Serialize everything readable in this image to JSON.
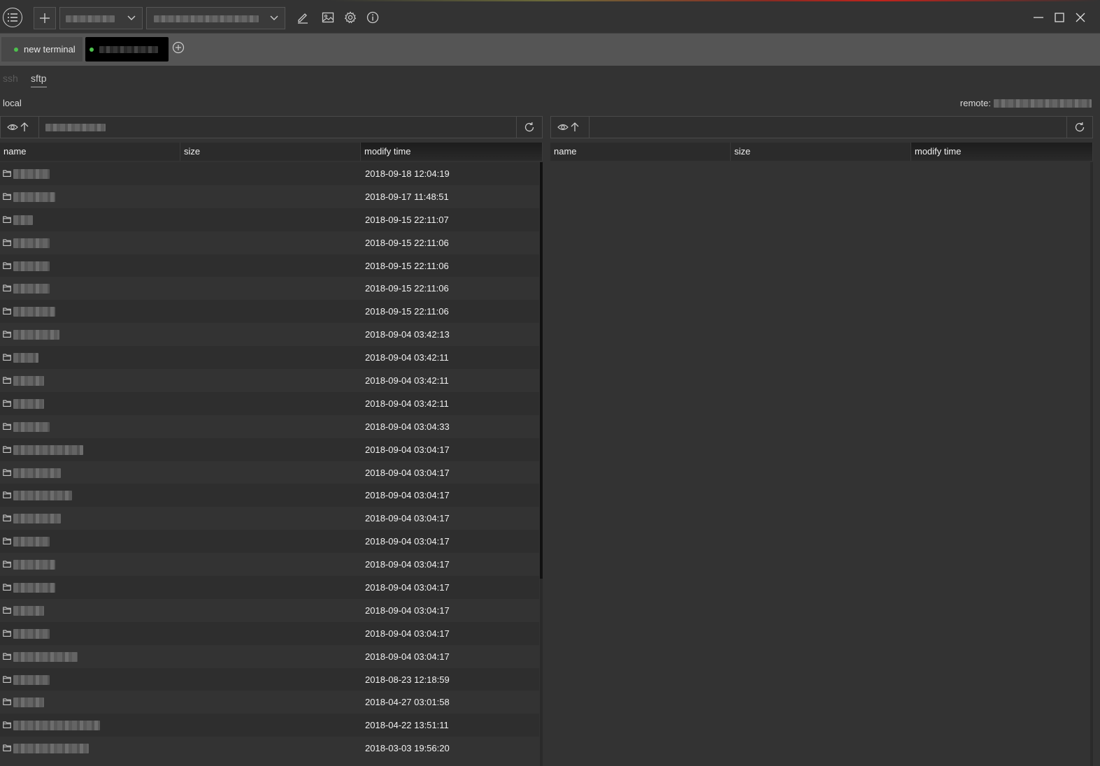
{
  "colors": {
    "background": "#333333",
    "tab_bar": "#555555",
    "active_tab": "#000000",
    "status_dot": "#4dc14d",
    "text": "#e6e6e6"
  },
  "toolbar": {
    "icons": [
      "menu-icon",
      "plus-icon",
      "chevron-down-icon",
      "edit-icon",
      "image-icon",
      "gear-icon",
      "info-icon",
      "minimize-icon",
      "maximize-icon",
      "close-icon"
    ]
  },
  "tabs": [
    {
      "label": "new terminal",
      "active": false
    },
    {
      "label": "",
      "active": true
    }
  ],
  "subtabs": {
    "ssh": "ssh",
    "sftp": "sftp"
  },
  "local": {
    "label": "local",
    "path": "",
    "columns": {
      "name": "name",
      "size": "size",
      "mtime": "modify time"
    },
    "rows": [
      {
        "name": "",
        "mtime": "2018-09-18 12:04:19"
      },
      {
        "name": "",
        "mtime": "2018-09-17 11:48:51"
      },
      {
        "name": "",
        "mtime": "2018-09-15 22:11:07"
      },
      {
        "name": "",
        "mtime": "2018-09-15 22:11:06"
      },
      {
        "name": "",
        "mtime": "2018-09-15 22:11:06"
      },
      {
        "name": "",
        "mtime": "2018-09-15 22:11:06"
      },
      {
        "name": "",
        "mtime": "2018-09-15 22:11:06"
      },
      {
        "name": "",
        "mtime": "2018-09-04 03:42:13"
      },
      {
        "name": "",
        "mtime": "2018-09-04 03:42:11"
      },
      {
        "name": "",
        "mtime": "2018-09-04 03:42:11"
      },
      {
        "name": "",
        "mtime": "2018-09-04 03:42:11"
      },
      {
        "name": "",
        "mtime": "2018-09-04 03:04:33"
      },
      {
        "name": "",
        "mtime": "2018-09-04 03:04:17"
      },
      {
        "name": "",
        "mtime": "2018-09-04 03:04:17"
      },
      {
        "name": "",
        "mtime": "2018-09-04 03:04:17"
      },
      {
        "name": "",
        "mtime": "2018-09-04 03:04:17"
      },
      {
        "name": "",
        "mtime": "2018-09-04 03:04:17"
      },
      {
        "name": "",
        "mtime": "2018-09-04 03:04:17"
      },
      {
        "name": "",
        "mtime": "2018-09-04 03:04:17"
      },
      {
        "name": "",
        "mtime": "2018-09-04 03:04:17"
      },
      {
        "name": "",
        "mtime": "2018-09-04 03:04:17"
      },
      {
        "name": "",
        "mtime": "2018-09-04 03:04:17"
      },
      {
        "name": "",
        "mtime": "2018-08-23 12:18:59"
      },
      {
        "name": "",
        "mtime": "2018-04-27 03:01:58"
      },
      {
        "name": "",
        "mtime": "2018-04-22 13:51:11"
      },
      {
        "name": "",
        "mtime": "2018-03-03 19:56:20"
      }
    ]
  },
  "remote": {
    "label": "remote:",
    "path": "",
    "columns": {
      "name": "name",
      "size": "size",
      "mtime": "modify time"
    },
    "rows": []
  }
}
